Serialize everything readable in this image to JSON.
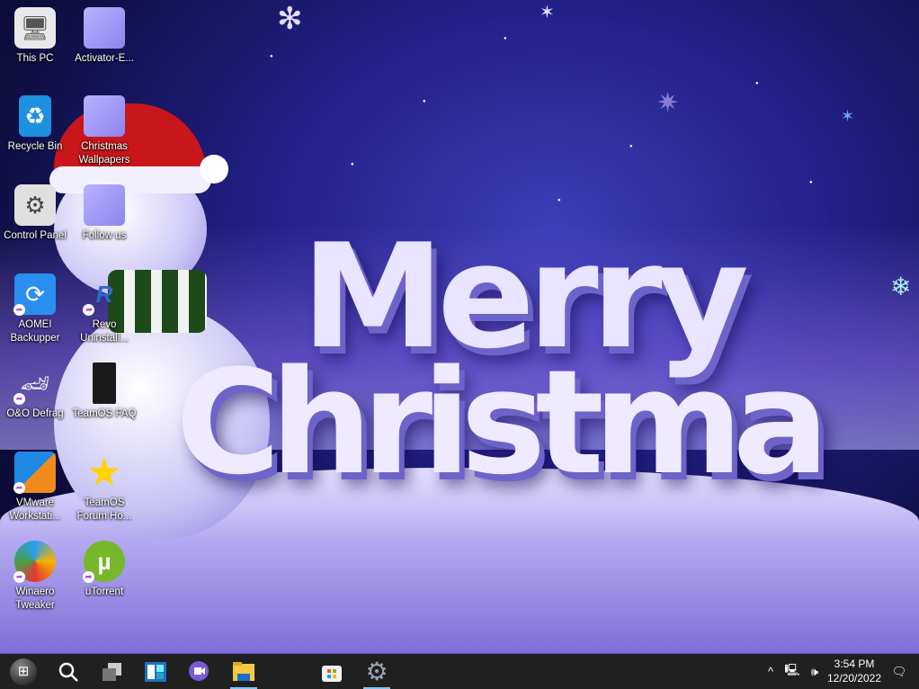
{
  "desktop": {
    "icons": [
      {
        "label": "This PC",
        "icon": "computer-icon"
      },
      {
        "label": "Activator-E...",
        "icon": "file-icon"
      },
      {
        "label": "Recycle Bin",
        "icon": "recycle-bin-icon"
      },
      {
        "label": "Christmas Wallpapers",
        "icon": "file-icon"
      },
      {
        "label": "Control Panel",
        "icon": "gear-icon"
      },
      {
        "label": "Follow us",
        "icon": "file-icon"
      },
      {
        "label": "AOMEI Backupper",
        "icon": "backup-icon"
      },
      {
        "label": "Revo Uninstall...",
        "icon": "uninstaller-icon"
      },
      {
        "label": "O&O Defrag",
        "icon": "defrag-icon"
      },
      {
        "label": "TeamOS FAQ",
        "icon": "document-icon"
      },
      {
        "label": "VMware Workstati...",
        "icon": "vmware-icon"
      },
      {
        "label": "TeamOS Forum Ho...",
        "icon": "star-icon"
      },
      {
        "label": "Winaero Tweaker",
        "icon": "tweaker-icon"
      },
      {
        "label": "uTorrent",
        "icon": "utorrent-icon"
      }
    ],
    "wallpaper_text": [
      "Merry",
      "Christma"
    ]
  },
  "taskbar": {
    "items": [
      "start",
      "search",
      "task-view",
      "widgets",
      "chat",
      "file-explorer",
      "microsoft-store",
      "settings"
    ],
    "time": "3:54 PM",
    "date": "12/20/2022",
    "tray_chevron": "^"
  }
}
